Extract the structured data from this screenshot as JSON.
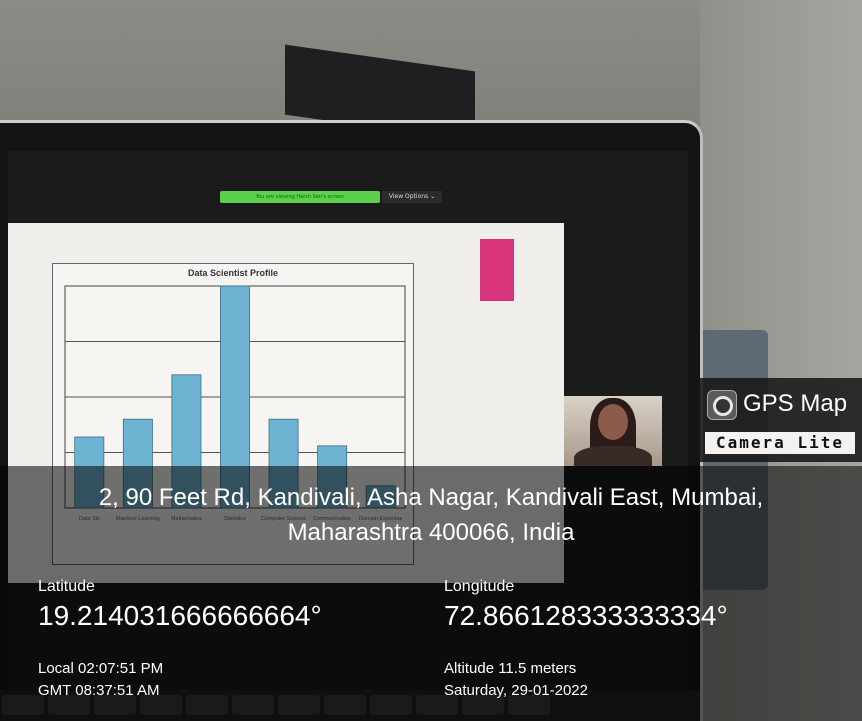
{
  "scene": {
    "zoom_banner": "You are viewing Harsh Sen's screen",
    "view_options": "View Options ⌄"
  },
  "chart_data": {
    "type": "bar",
    "title": "Data Scientist Profile",
    "categories": [
      "Data Ski",
      "Machine Learning",
      "Mathematics",
      "Statistics",
      "Computer Science",
      "Communication",
      "Domain Expertise"
    ],
    "values": [
      32,
      40,
      60,
      100,
      40,
      28,
      10
    ],
    "ylim": [
      0,
      100
    ],
    "color": "#6fb3d3",
    "grid": true
  },
  "gps": {
    "app_title": "GPS Map",
    "app_subtitle": "Camera Lite",
    "address_line1": "2, 90 Feet Rd, Kandivali, Asha Nagar, Kandivali East, Mumbai,",
    "address_line2": "Maharashtra 400066, India",
    "latitude_label": "Latitude",
    "latitude_value": "19.214031666666664°",
    "longitude_label": "Longitude",
    "longitude_value": "72.866128333333334°",
    "local_time": "Local 02:07:51 PM",
    "gmt_time": "GMT 08:37:51 AM",
    "altitude": "Altitude 11.5 meters",
    "date": "Saturday, 29-01-2022"
  }
}
